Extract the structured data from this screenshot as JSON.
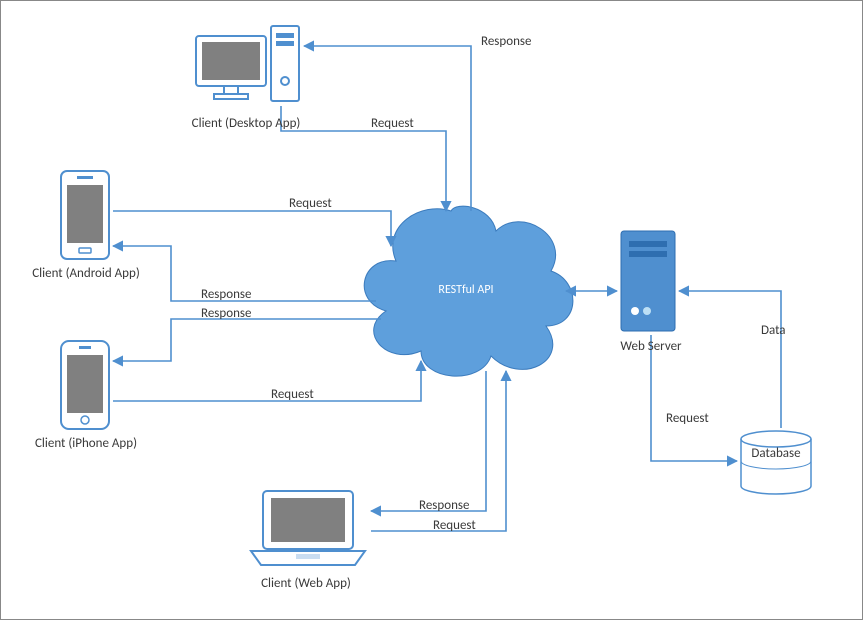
{
  "diagram": {
    "center": {
      "label": "RESTful API"
    },
    "nodes": {
      "desktop": {
        "caption": "Client (Desktop App)"
      },
      "android": {
        "caption": "Client (Android App)"
      },
      "iphone": {
        "caption": "Client (iPhone App)"
      },
      "web": {
        "caption": "Client (Web App)"
      },
      "server": {
        "caption": "Web Server"
      },
      "database": {
        "caption": "Database"
      }
    },
    "edges": {
      "desktop_response": "Response",
      "desktop_request": "Request",
      "android_request": "Request",
      "android_response": "Response",
      "iphone_request": "Request",
      "iphone_response": "Response",
      "web_response": "Response",
      "web_request": "Request",
      "server_request": "Request",
      "server_data": "Data"
    }
  },
  "colors": {
    "stroke": "#4f8fcf",
    "fill": "#5e9fdc",
    "screen": "#808080",
    "dark": "#2e6eb0",
    "text": "#404040",
    "white": "#ffffff"
  }
}
